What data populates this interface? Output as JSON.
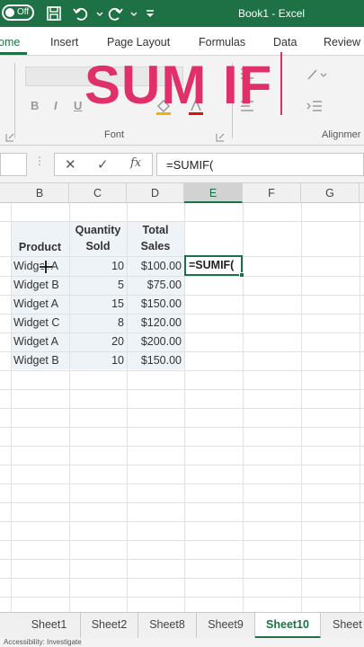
{
  "titlebar": {
    "autosave_state": "Off",
    "title": "Book1  -  Excel"
  },
  "tabs": [
    "ome",
    "Insert",
    "Page Layout",
    "Formulas",
    "Data",
    "Review"
  ],
  "ribbon": {
    "font_group_label": "Font",
    "alignment_group_label": "Alignmer",
    "bold": "B",
    "italic": "I",
    "underline": "U"
  },
  "overlay_title": "SUM IF",
  "formula_bar": {
    "cancel": "✕",
    "enter": "✓",
    "fx": "fx",
    "value": "=SUMIF("
  },
  "columns": [
    "B",
    "C",
    "D",
    "E",
    "F",
    "G"
  ],
  "table": {
    "headers": {
      "product": "Product",
      "qty": "Quantity Sold",
      "total": "Total Sales"
    },
    "rows": [
      {
        "product": "Widget A",
        "qty": "10",
        "total": "$100.00"
      },
      {
        "product": "Widget B",
        "qty": "5",
        "total": "$75.00"
      },
      {
        "product": "Widget A",
        "qty": "15",
        "total": "$150.00"
      },
      {
        "product": "Widget C",
        "qty": "8",
        "total": "$120.00"
      },
      {
        "product": "Widget A",
        "qty": "20",
        "total": "$200.00"
      },
      {
        "product": "Widget B",
        "qty": "10",
        "total": "$150.00"
      }
    ]
  },
  "active_cell_value": "=SUMIF(",
  "sheets": [
    "Sheet1",
    "Sheet2",
    "Sheet8",
    "Sheet9",
    "Sheet10",
    "Sheet"
  ],
  "active_sheet": "Sheet10",
  "status": "Accessibility: Investigate",
  "colors": {
    "excel_green": "#1e7145",
    "overlay_pink": "#e0306a",
    "table_shade": "#eef3f7"
  }
}
